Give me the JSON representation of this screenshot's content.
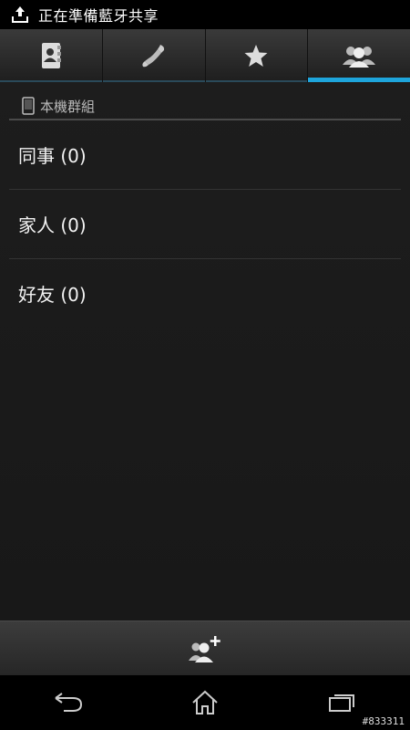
{
  "status_bar": {
    "notification_text": "正在準備藍牙共享",
    "icon": "upload-icon"
  },
  "tabs": [
    {
      "name": "contacts",
      "icon": "contacts-book-icon",
      "active": false
    },
    {
      "name": "phone",
      "icon": "phone-handset-icon",
      "active": false
    },
    {
      "name": "favorites",
      "icon": "star-icon",
      "active": false
    },
    {
      "name": "groups",
      "icon": "groups-icon",
      "active": true
    }
  ],
  "section": {
    "header": "本機群組",
    "icon": "device-phone-icon"
  },
  "groups": [
    {
      "label": "同事 (0)"
    },
    {
      "label": "家人 (0)"
    },
    {
      "label": "好友 (0)"
    }
  ],
  "action_bar": {
    "icon": "add-group-icon"
  },
  "nav_bar": {
    "buttons": [
      "back-icon",
      "home-icon",
      "recent-apps-icon"
    ]
  },
  "watermark": "#833311",
  "colors": {
    "accent": "#1ea5dc",
    "background": "#1b1b1b"
  }
}
